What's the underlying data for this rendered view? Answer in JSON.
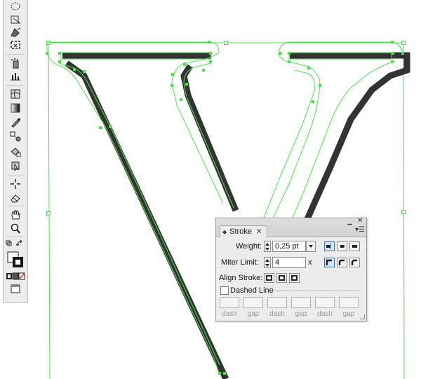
{
  "canvas": {
    "guide_color": "#4de04d",
    "shadow_color": "#333333",
    "letter": "V"
  },
  "toolbar": {
    "tools": [
      "lasso-icon",
      "free-transform-icon",
      "shape-builder-icon",
      "selection-grid-icon",
      "symbol-sprayer-icon",
      "column-graph-icon",
      "mesh-icon",
      "gradient-icon",
      "eyedropper-icon",
      "blend-icon",
      "live-paint-icon",
      "live-paint-select-icon",
      "slice-icon",
      "eraser-icon",
      "hand-icon",
      "zoom-icon"
    ]
  },
  "stroke_panel": {
    "tab_label": "Stroke",
    "weight_label": "Weight:",
    "weight_value": "0,25 pt",
    "miter_label": "Miter Limit:",
    "miter_value": "4",
    "miter_unit": "x",
    "align_label": "Align Stroke:",
    "dashed_label": "Dashed Line",
    "dashed_checked": false,
    "dash_labels": [
      "dash",
      "gap",
      "dash",
      "gap",
      "dash",
      "gap"
    ]
  }
}
